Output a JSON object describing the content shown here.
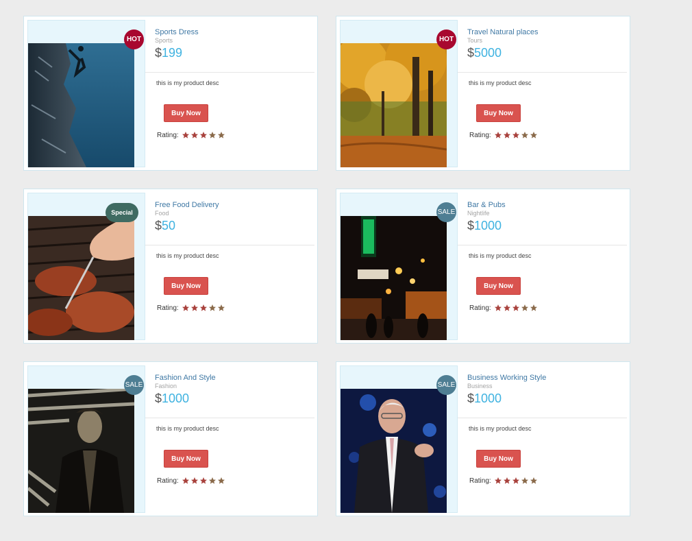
{
  "products": [
    {
      "title": "Sports Dress",
      "category": "Sports",
      "currency": "$",
      "price": "199",
      "badge": "HOT",
      "badge_type": "hot",
      "desc": "this is my product desc",
      "button": "Buy Now",
      "rating_label": "Rating:",
      "rating": 5,
      "image": "rock-climber-photo"
    },
    {
      "title": "Travel Natural places",
      "category": "Tours",
      "currency": "$",
      "price": "5000",
      "badge": "HOT",
      "badge_type": "hot",
      "desc": "this is my product desc",
      "button": "Buy Now",
      "rating_label": "Rating:",
      "rating": 5,
      "image": "autumn-forest-photo"
    },
    {
      "title": "Free Food Delivery",
      "category": "Food",
      "currency": "$",
      "price": "50",
      "badge": "Special",
      "badge_type": "special",
      "desc": "this is my product desc",
      "button": "Buy Now",
      "rating_label": "Rating:",
      "rating": 5,
      "image": "grilled-steak-photo"
    },
    {
      "title": "Bar & Pubs",
      "category": "Nightlife",
      "currency": "$",
      "price": "1000",
      "badge": "SALE",
      "badge_type": "sale",
      "desc": "this is my product desc",
      "button": "Buy Now",
      "rating_label": "Rating:",
      "rating": 5,
      "image": "night-street-bar-photo"
    },
    {
      "title": "Fashion And Style",
      "category": "Fashion",
      "currency": "$",
      "price": "1000",
      "badge": "SALE",
      "badge_type": "sale",
      "desc": "this is my product desc",
      "button": "Buy Now",
      "rating_label": "Rating:",
      "rating": 5,
      "image": "man-leather-jacket-photo"
    },
    {
      "title": "Business Working Style",
      "category": "Business",
      "currency": "$",
      "price": "1000",
      "badge": "SALE",
      "badge_type": "sale",
      "desc": "this is my product desc",
      "button": "Buy Now",
      "rating_label": "Rating:",
      "rating": 5,
      "image": "business-speaker-photo"
    }
  ],
  "colors": {
    "badge_hot": "#a8082f",
    "badge_sale": "#4e7e93",
    "badge_special": "#3f6b62",
    "button": "#d9534f",
    "price": "#3eb2e0",
    "title": "#3f78a4",
    "star": "#a8413c"
  }
}
